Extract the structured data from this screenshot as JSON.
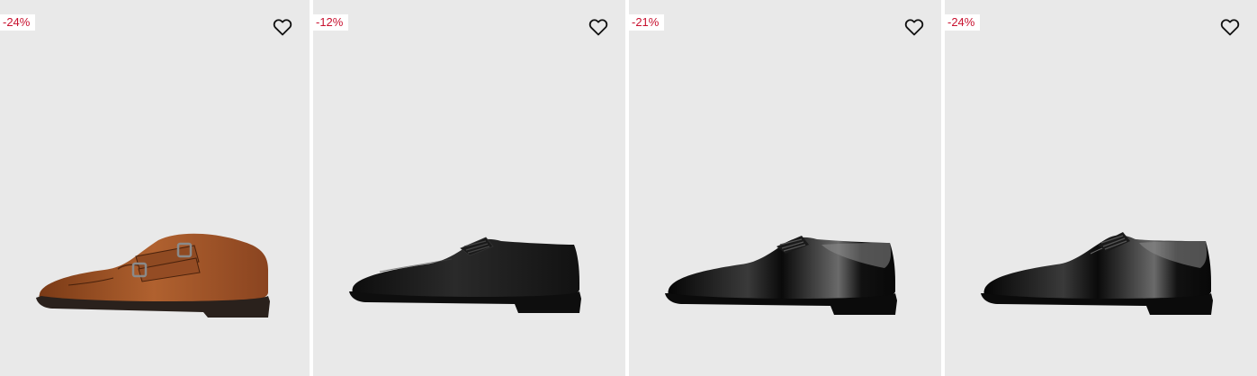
{
  "products": [
    {
      "discount": "-24%",
      "image": "brown-double-monk-strap-shoe",
      "wishlist_icon": "heart-outline-icon",
      "colors": {
        "upper": "#a8572a",
        "upper_dark": "#6e3416",
        "sole": "#2a211c"
      }
    },
    {
      "discount": "-12%",
      "image": "black-leather-oxford-shoe",
      "wishlist_icon": "heart-outline-icon",
      "colors": {
        "upper": "#1c1c1c",
        "upper_dark": "#0c0c0c",
        "sole": "#111111"
      }
    },
    {
      "discount": "-21%",
      "image": "black-patent-leather-oxford-shoe",
      "wishlist_icon": "heart-outline-icon",
      "colors": {
        "upper": "#141414",
        "upper_dark": "#050505",
        "sole": "#111111"
      }
    },
    {
      "discount": "-24%",
      "image": "black-patent-leather-derby-shoe",
      "wishlist_icon": "heart-outline-icon",
      "colors": {
        "upper": "#141414",
        "upper_dark": "#050505",
        "sole": "#111111"
      }
    }
  ],
  "theme": {
    "card_background": "#e9e9e9",
    "badge_text": "#c8102e",
    "badge_background": "#ffffff"
  }
}
